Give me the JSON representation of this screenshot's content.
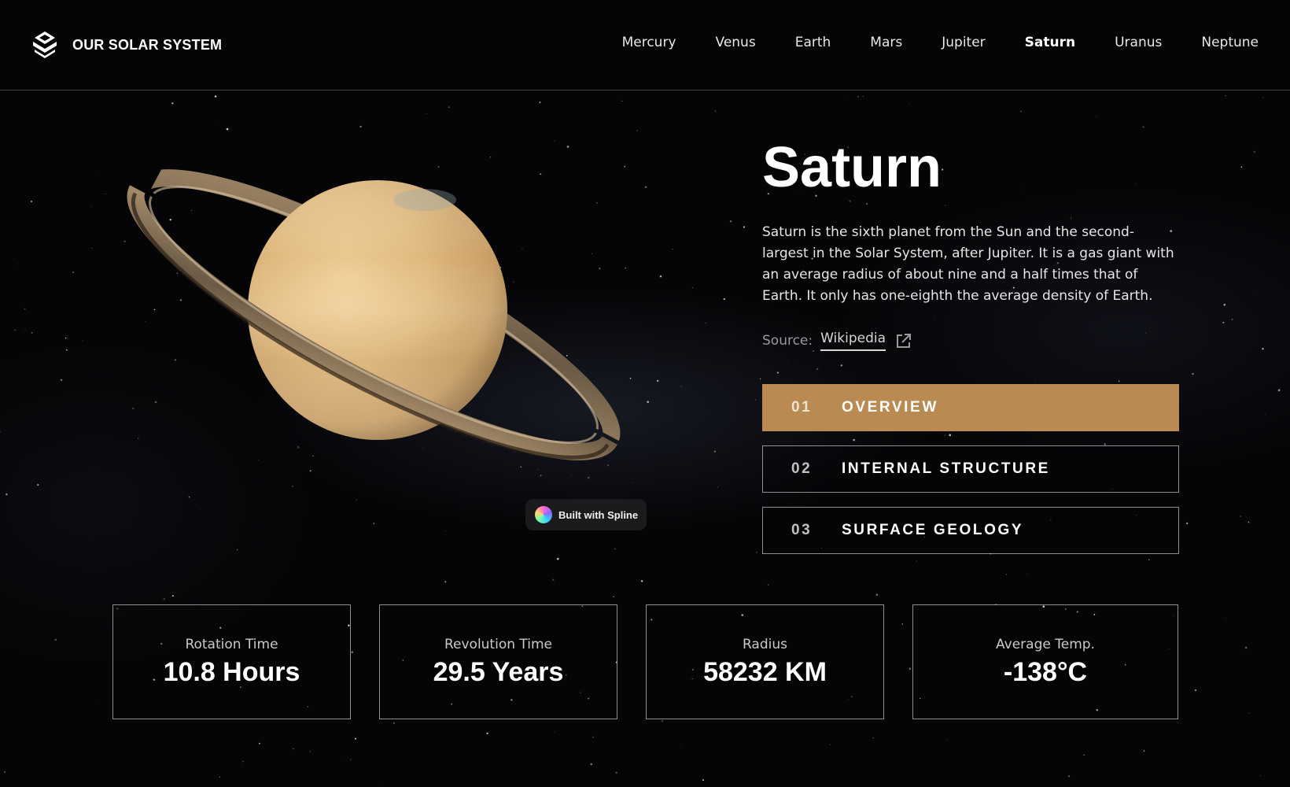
{
  "header": {
    "logo_text": "OUR SOLAR SYSTEM",
    "nav": [
      {
        "label": "Mercury",
        "active": false
      },
      {
        "label": "Venus",
        "active": false
      },
      {
        "label": "Earth",
        "active": false
      },
      {
        "label": "Mars",
        "active": false
      },
      {
        "label": "Jupiter",
        "active": false
      },
      {
        "label": "Saturn",
        "active": true
      },
      {
        "label": "Uranus",
        "active": false
      },
      {
        "label": "Neptune",
        "active": false
      }
    ]
  },
  "planet": {
    "name": "Saturn",
    "description": "Saturn is the sixth planet from the Sun and the second-largest in the Solar System, after Jupiter. It is a gas giant with an average radius of about nine and a half times that of Earth. It only has one-eighth the average density of Earth.",
    "source_label": "Source:",
    "source_link": "Wikipedia"
  },
  "badge": {
    "text": "Built with Spline"
  },
  "tabs": [
    {
      "number": "01",
      "label": "OVERVIEW",
      "active": true
    },
    {
      "number": "02",
      "label": "INTERNAL STRUCTURE",
      "active": false
    },
    {
      "number": "03",
      "label": "SURFACE GEOLOGY",
      "active": false
    }
  ],
  "stats": [
    {
      "label": "Rotation Time",
      "value": "10.8 Hours"
    },
    {
      "label": "Revolution Time",
      "value": "29.5 Years"
    },
    {
      "label": "Radius",
      "value": "58232 KM"
    },
    {
      "label": "Average Temp.",
      "value": "-138°C"
    }
  ],
  "colors": {
    "accent": "#b98b52",
    "background": "#050507",
    "border": "#8c8c8c"
  },
  "icons": {
    "logo": "solar-system-logo-icon",
    "external_link": "external-link-icon",
    "spline": "spline-logo-icon"
  }
}
